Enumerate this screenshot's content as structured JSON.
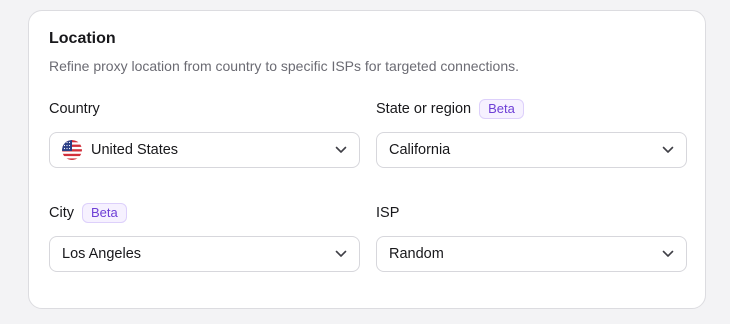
{
  "location": {
    "title": "Location",
    "description": "Refine proxy location from country to specific ISPs for targeted connections."
  },
  "fields": {
    "country": {
      "label": "Country",
      "value": "United States",
      "flag_icon": "us-flag-icon"
    },
    "state": {
      "label": "State or region",
      "badge": "Beta",
      "value": "California"
    },
    "city": {
      "label": "City",
      "badge": "Beta",
      "value": "Los Angeles"
    },
    "isp": {
      "label": "ISP",
      "value": "Random"
    }
  },
  "colors": {
    "badge_text": "#6e3fd6",
    "badge_bg": "#f6f1ff",
    "border": "#d7d7dc"
  }
}
